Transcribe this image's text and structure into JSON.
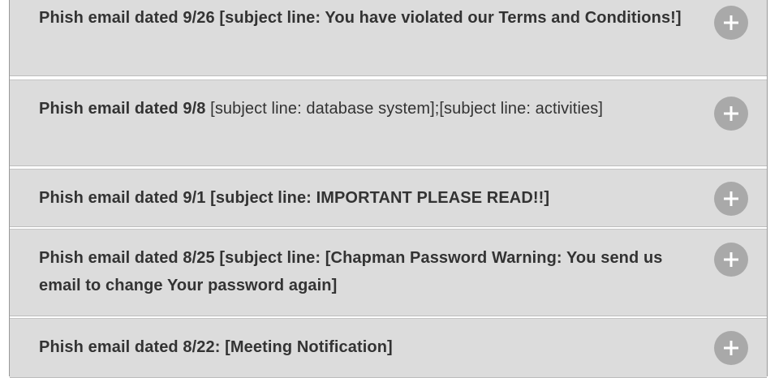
{
  "accordion": {
    "items": [
      {
        "lead": "Phish email dated 9/26",
        "rest": " [subject line: You have violated our Terms and Conditions!]",
        "expand_icon": "plus-circle-icon"
      },
      {
        "lead": "Phish email dated 9/8",
        "rest": " [subject line: database system];[subject line: activities]",
        "expand_icon": "plus-circle-icon"
      },
      {
        "lead": "Phish email dated 9/1",
        "rest": " [subject line: IMPORTANT PLEASE READ!!]",
        "expand_icon": "plus-circle-icon"
      },
      {
        "lead": "Phish email dated 8/25",
        "rest": " [subject line: [Chapman Password Warning: You send us email to change Your password again]",
        "expand_icon": "plus-circle-icon"
      },
      {
        "lead": "Phish email dated 8/22:",
        "rest": " [Meeting Notification]",
        "expand_icon": "plus-circle-icon"
      }
    ]
  },
  "colors": {
    "panel_background": "#dcdcdc",
    "text": "#333333",
    "icon_circle": "#a9a9a9",
    "icon_plus": "#ffffff"
  }
}
